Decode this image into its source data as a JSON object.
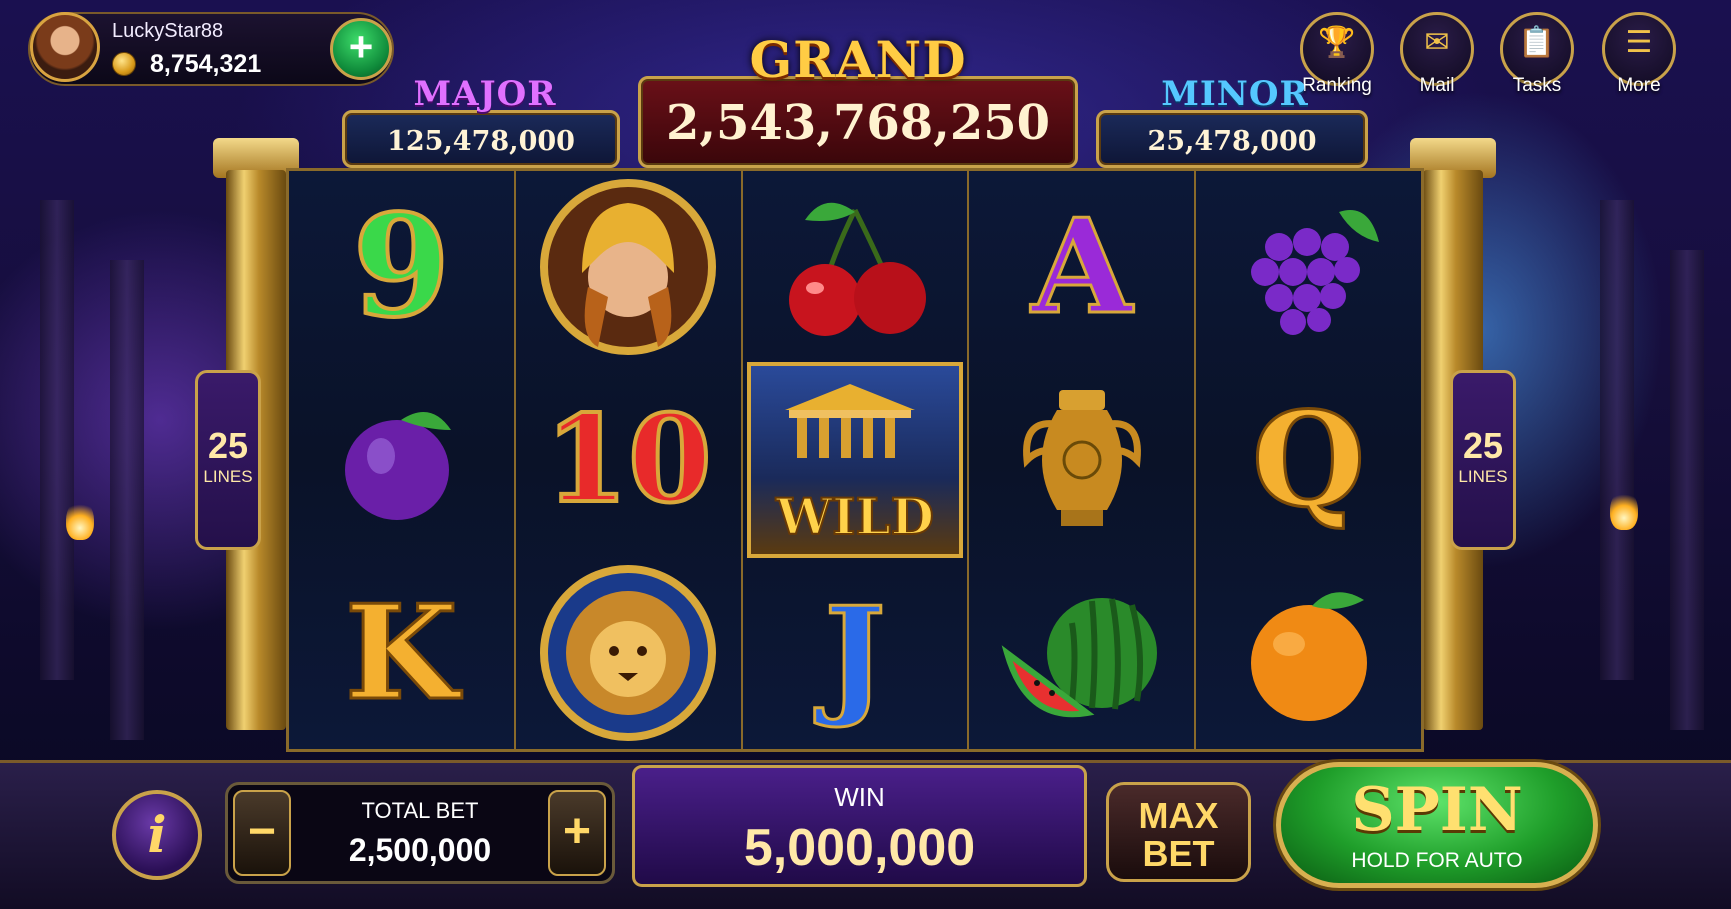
{
  "profile": {
    "username": "LuckyStar88",
    "balance": "8,754,321",
    "add_label": "+"
  },
  "top_menu": [
    {
      "label": "Ranking",
      "icon": "trophy-icon"
    },
    {
      "label": "Mail",
      "icon": "mail-icon"
    },
    {
      "label": "Tasks",
      "icon": "clipboard-icon"
    },
    {
      "label": "More",
      "icon": "menu-icon"
    }
  ],
  "jackpots": {
    "grand": {
      "title": "GRAND",
      "value": "2,543,768,250"
    },
    "major": {
      "title": "MAJOR",
      "value": "125,478,000"
    },
    "minor": {
      "title": "MINOR",
      "value": "25,478,000"
    }
  },
  "paylines": {
    "count": "25",
    "label": "LINES"
  },
  "reels": [
    [
      "9",
      "plum",
      "K"
    ],
    [
      "warrior",
      "10",
      "lion"
    ],
    [
      "cherries",
      "WILD",
      "J"
    ],
    [
      "A",
      "urn",
      "watermelon"
    ],
    [
      "grapes",
      "Q",
      "orange"
    ]
  ],
  "wild_label": "WILD",
  "bet": {
    "label": "TOTAL BET",
    "value": "2,500,000",
    "minus": "−",
    "plus": "+"
  },
  "win": {
    "label": "WIN",
    "value": "5,000,000"
  },
  "info_label": "i",
  "max_bet": {
    "line1": "MAX",
    "line2": "BET"
  },
  "spin": {
    "label": "SPIN",
    "sub": "HOLD FOR AUTO"
  },
  "colors": {
    "gold": "#c9a24a",
    "spin_green": "#1f9e2a",
    "win_purple": "#4a1f8a",
    "grand_red": "#5a0f14"
  }
}
